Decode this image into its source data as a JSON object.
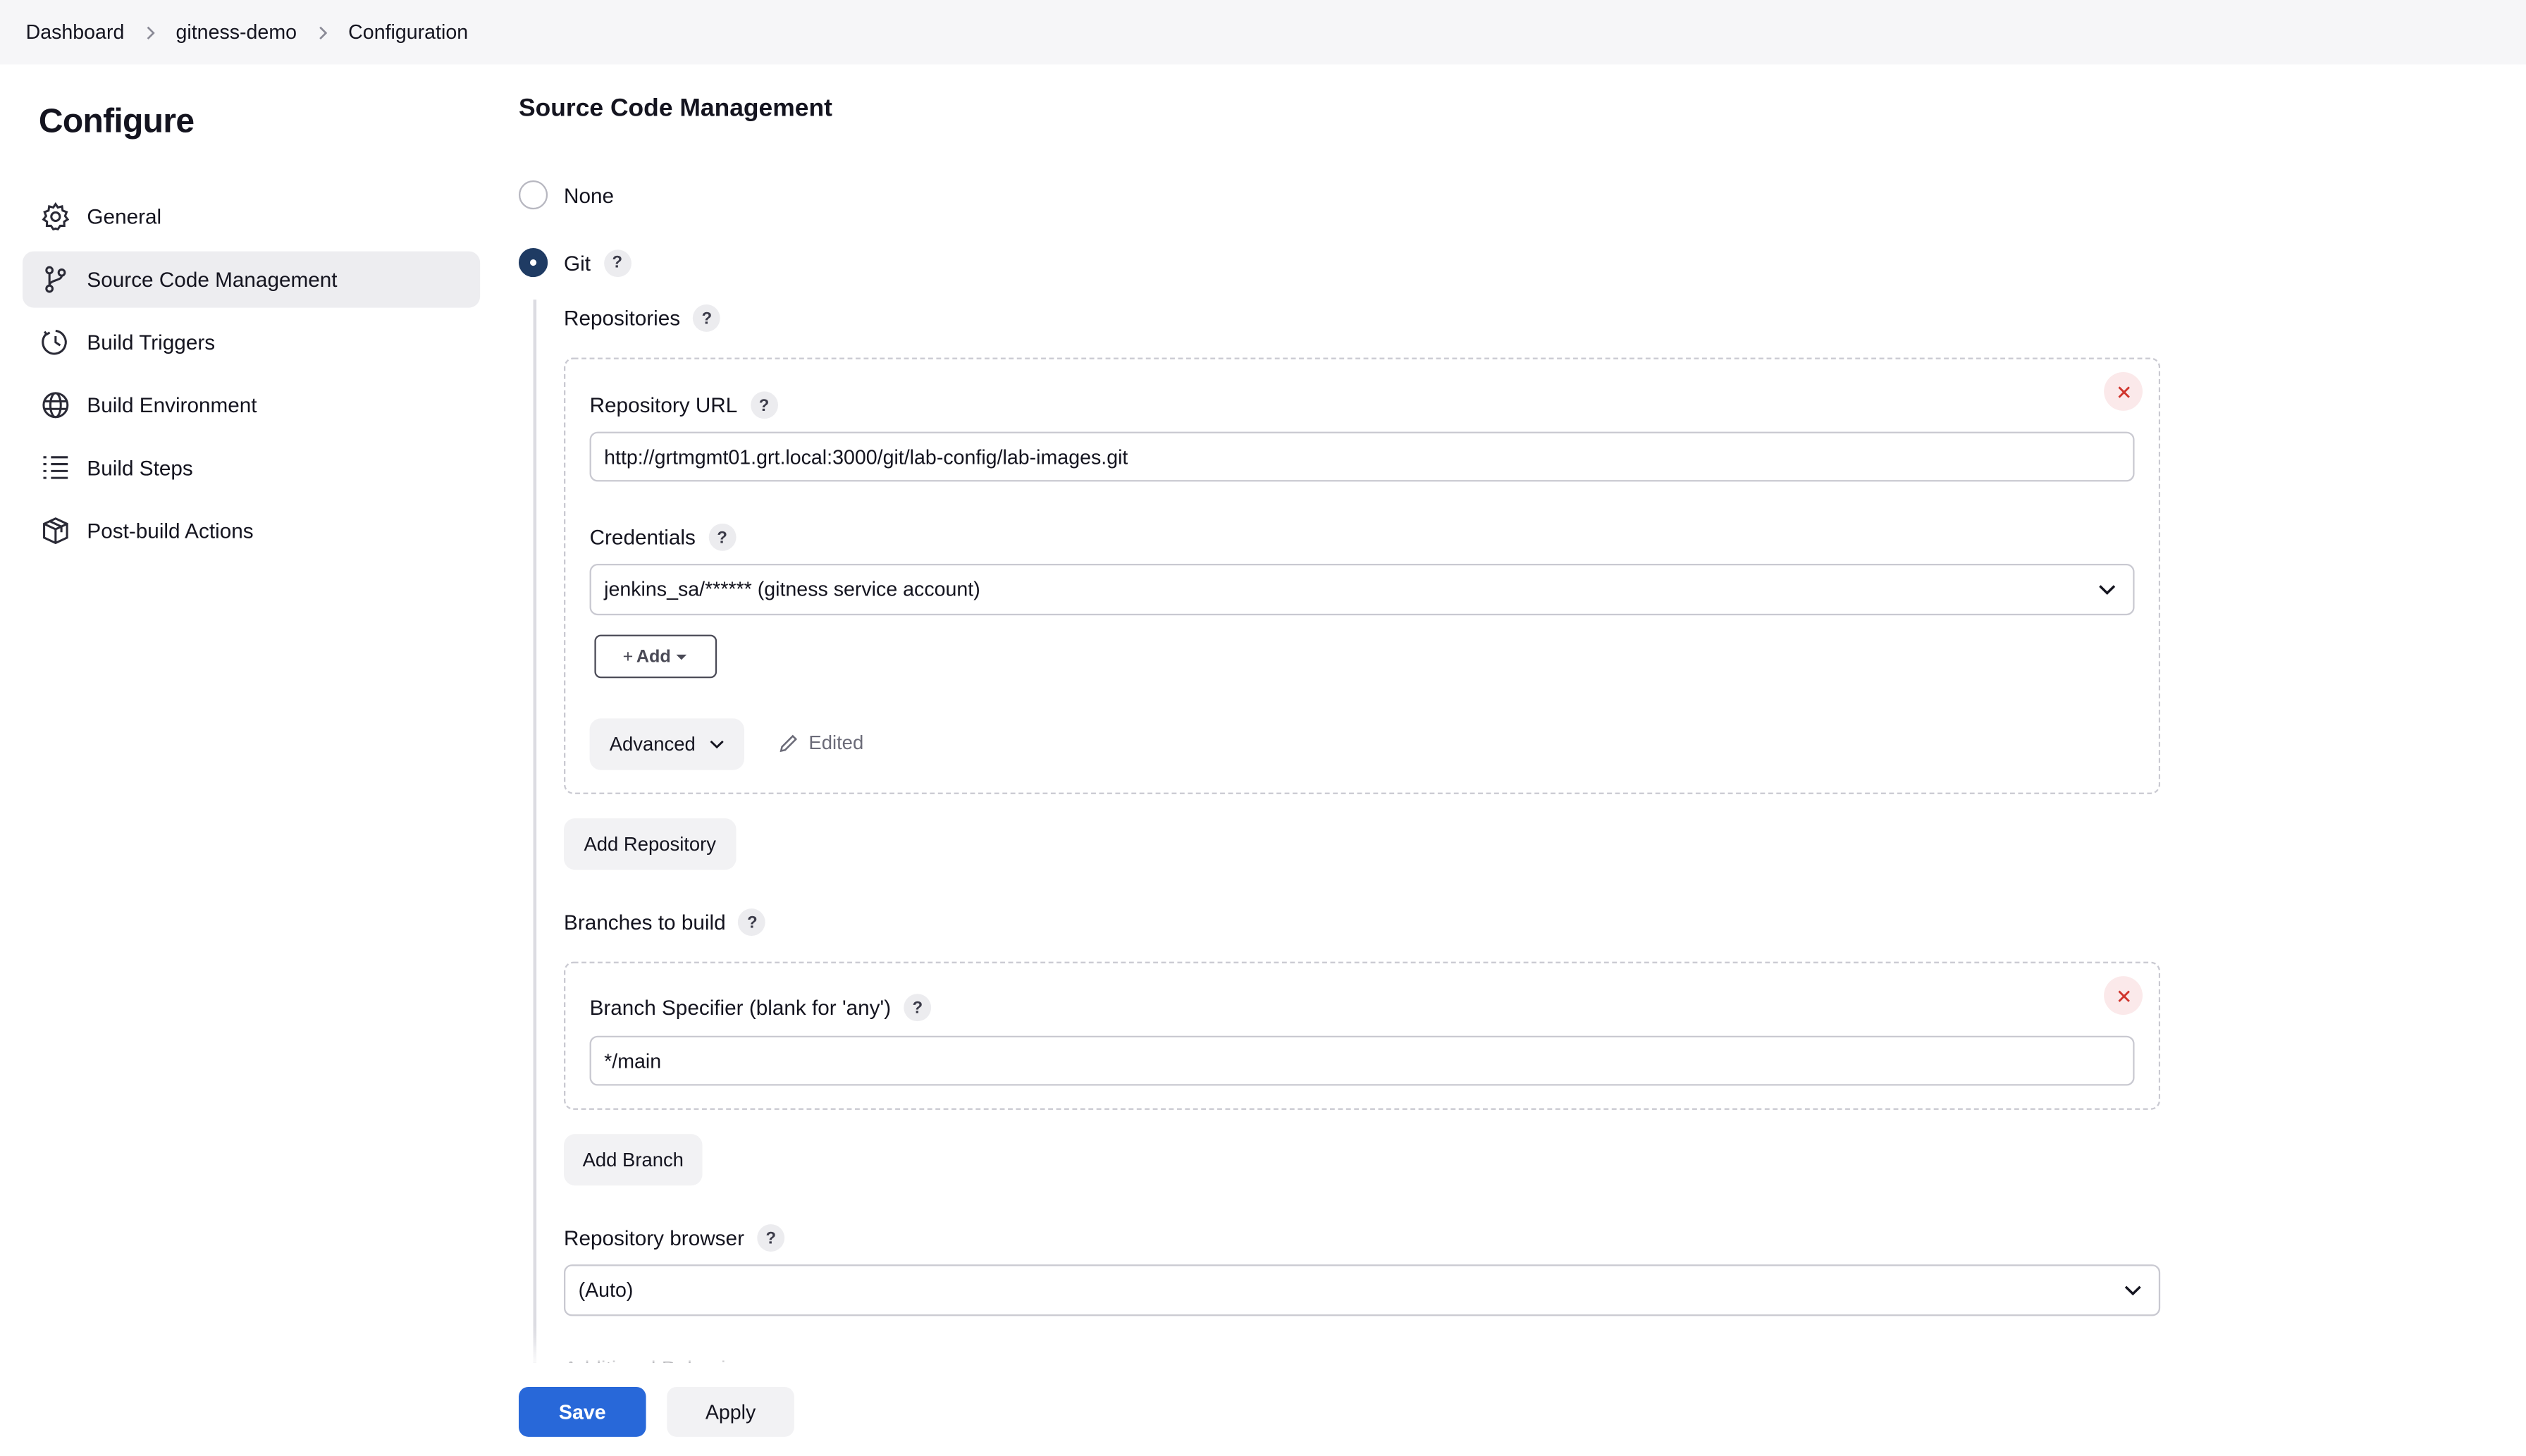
{
  "breadcrumb": [
    "Dashboard",
    "gitness-demo",
    "Configuration"
  ],
  "sidebar": {
    "title": "Configure",
    "items": [
      {
        "label": "General",
        "icon": "gear-icon",
        "active": false
      },
      {
        "label": "Source Code Management",
        "icon": "git-branch-icon",
        "active": true
      },
      {
        "label": "Build Triggers",
        "icon": "clock-icon",
        "active": false
      },
      {
        "label": "Build Environment",
        "icon": "globe-icon",
        "active": false
      },
      {
        "label": "Build Steps",
        "icon": "list-icon",
        "active": false
      },
      {
        "label": "Post-build Actions",
        "icon": "package-icon",
        "active": false
      }
    ]
  },
  "scm": {
    "title": "Source Code Management",
    "options": {
      "none": "None",
      "git": "Git"
    },
    "selected": "git",
    "help": "?",
    "repositories_label": "Repositories",
    "repo_url_label": "Repository URL",
    "repo_url_value": "http://grtmgmt01.grt.local:3000/git/lab-config/lab-images.git",
    "credentials_label": "Credentials",
    "credentials_value": "jenkins_sa/****** (gitness service account)",
    "add_label": "Add",
    "advanced_label": "Advanced",
    "edited_label": "Edited",
    "add_repository_label": "Add Repository",
    "branches_label": "Branches to build",
    "branch_spec_label": "Branch Specifier (blank for 'any')",
    "branch_spec_value": "*/main",
    "add_branch_label": "Add Branch",
    "repo_browser_label": "Repository browser",
    "repo_browser_value": "(Auto)",
    "next_section_label": "Additional Behaviours"
  },
  "footer": {
    "save_label": "Save",
    "apply_label": "Apply"
  },
  "colors": {
    "accent": "#2868d9",
    "radio_checked": "#1f3b63",
    "close_bg": "#fbe9ea",
    "close_x": "#d0342c"
  }
}
